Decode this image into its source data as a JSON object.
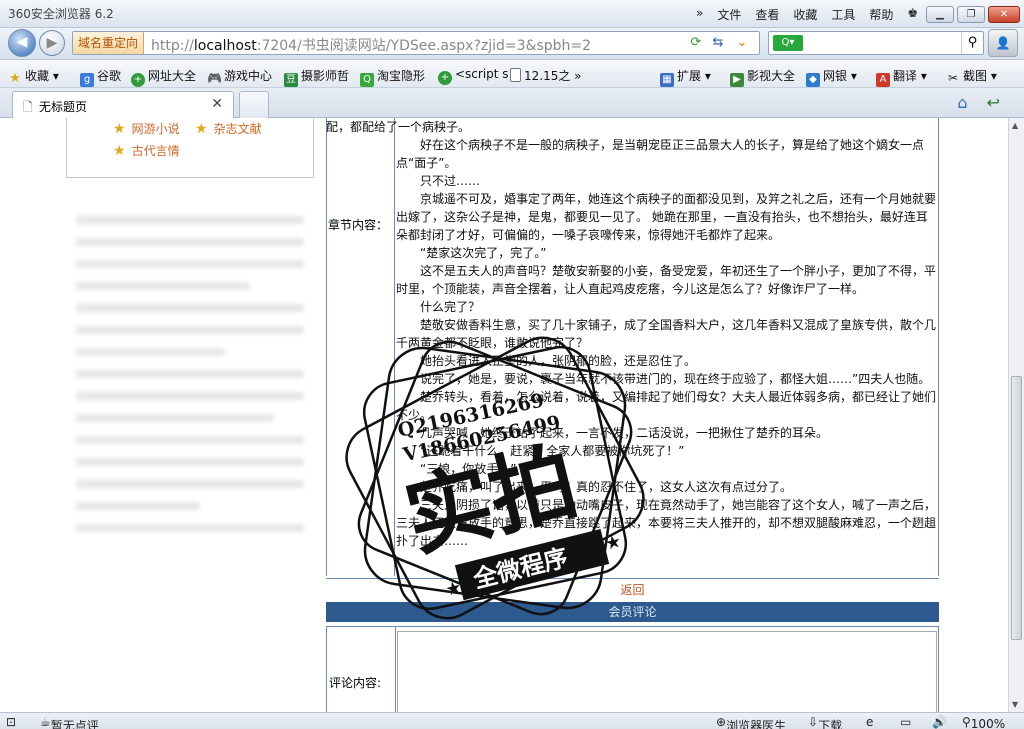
{
  "window": {
    "title": "360安全浏览器 6.2",
    "menus": [
      "文件",
      "查看",
      "收藏",
      "工具",
      "帮助"
    ]
  },
  "navbar": {
    "redirect_label": "域名重定向",
    "url_prefix": "http://",
    "url_host": "localhost",
    "url_rest": ":7204/书虫阅读网站/YDSee.aspx?zjid=3&spbh=2",
    "search_placeholder": ""
  },
  "favorites": {
    "items": [
      "收藏",
      "谷歌",
      "网址大全",
      "游戏中心",
      "摄影师哲",
      "淘宝隐形",
      "<script s",
      "12.15之"
    ],
    "right_items": [
      "扩展",
      "影视大全",
      "网银",
      "翻译",
      "截图"
    ]
  },
  "tabs": [
    {
      "label": "无标题页"
    }
  ],
  "sidebar": {
    "links": [
      "网游小说",
      "杂志文献",
      "古代言情"
    ]
  },
  "chapter": {
    "label": "章节内容：",
    "paragraphs": [
      "配，都配给了一个病秧子。",
      "好在这个病秧子不是一般的病秧子，是当朝宠臣正三品景大人的长子，算是给了她这个嫡女一点点“面子”。",
      "只不过……",
      "京城遥不可及，婚事定了两年，她连这个病秧子的面都没见到，及笄之礼之后，还有一个月她就要出嫁了，这杂公子是神，是鬼，都要见一见了。  她跪在那里，一直没有抬头，也不想抬头，最好连耳朵都封闭了才好，可偏偏的，一嗓子哀嚎传来，惊得她汗毛都炸了起来。",
      "“楚家这次完了，完了。”",
      "这不是五夫人的声音吗？楚敬安新娶的小妾，备受宠爱，年初还生了一个胖小子，更加了不得，平时里，个顶能装，声音全摆着，让人直起鸡皮疙瘩，今儿这是怎么了？好像诈尸了一样。",
      "什么完了？",
      "楚敬安做香料生意，买了几十家铺子，成了全国香料大户，这几年香料又混成了皇族专供，散个几千两黄金都不眨眼，谁敢说他完了？",
      "她抬头看进入正堂的人，张阴郁的脸，还是忍住了。",
      "说完了，她是，要说，裹子当年就不该带进门的，现在终于应验了，都怪大姐……”四夫人也随。",
      "楚乔转头，看着，怎么说着，说着，又编排起了她们母女？大夫人最近体弱多病，都已经让了她们不少。",
      "几声哭喊，她终于站了起来，一言不发，二话没说，一把揪住了楚乔的耳朵。",
      "“还跪着干什么，赶紧，全家人都要被你坑死了！”",
      "“三娘，你放手！”",
      "楚乔吃痛，叫了出来，忍吗？真的忍不住了，这女人这次有点过分了。",
      "三夫人阴损了话，以前只是动动嘴皮子，现在竟然动手了，她岂能容了这个女人，喊了一声之后，三夫人还是没放手的意思，楚乔直接跳了起来，本要将三夫人推开的，却不想双腿酸麻难忍，一个趔趄扑了出去……"
    ]
  },
  "back_link": "返回",
  "comment_header": "会员评论",
  "comment_label": "评论内容:",
  "watermark": {
    "qq": "Q2196316269",
    "vx": "V18660256499",
    "big": "实拍",
    "banner": "全微程序"
  },
  "status": {
    "reviews": "暂无点评",
    "doctor": "浏览器医生",
    "download": "下载",
    "zoom": "100%"
  }
}
